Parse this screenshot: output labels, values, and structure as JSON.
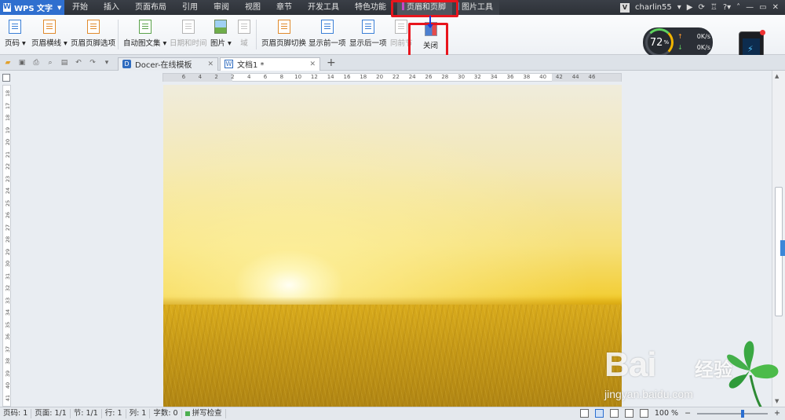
{
  "app": {
    "name": "WPS 文字"
  },
  "menu": {
    "tabs": [
      "开始",
      "插入",
      "页面布局",
      "引用",
      "审阅",
      "视图",
      "章节",
      "开发工具",
      "特色功能"
    ],
    "context_tabs": {
      "header_footer": "页眉和页脚",
      "picture_tools": "图片工具"
    }
  },
  "account": {
    "username": "charlin55"
  },
  "ribbon": {
    "page_number": "页码",
    "header_line": "页眉横线",
    "header_footer_options": "页眉页脚选项",
    "auto_text": "自动图文集",
    "date_time": "日期和时间",
    "picture": "图片",
    "field": "域",
    "switch_header_footer": "页眉页脚切换",
    "show_previous": "显示前一项",
    "show_next": "显示后一项",
    "same_as_previous": "同前节",
    "close": "关闭"
  },
  "speed_widget": {
    "percent": "72",
    "percent_unit": "%",
    "upload": "0K/s",
    "download": "0K/s"
  },
  "doc_tabs": [
    {
      "label": "Docer-在线模板"
    },
    {
      "label": "文档1 *"
    }
  ],
  "ruler": {
    "horizontal": [
      "6",
      "4",
      "2",
      "2",
      "4",
      "6",
      "8",
      "10",
      "12",
      "14",
      "16",
      "18",
      "20",
      "22",
      "24",
      "26",
      "28",
      "30",
      "32",
      "34",
      "36",
      "38",
      "40",
      "42",
      "44",
      "46"
    ],
    "vertical": [
      "18",
      "17",
      "18",
      "19",
      "20",
      "21",
      "22",
      "23",
      "24",
      "25",
      "26",
      "27",
      "28",
      "29",
      "30",
      "31",
      "32",
      "33",
      "34",
      "35",
      "36",
      "37",
      "38",
      "39",
      "40",
      "41",
      "42"
    ]
  },
  "status": {
    "page_num": "页码: 1",
    "page": "页面: 1/1",
    "section": "节: 1/1",
    "row": "行: 1",
    "col": "列: 1",
    "word_count": "字数: 0",
    "spell_check": "拼写检查",
    "zoom": "100 %",
    "zoom_level": 1.0
  },
  "watermark": {
    "logo": "Bai",
    "logo_cn": "经验",
    "url": "jingyan.baidu.com"
  },
  "colors": {
    "accent": "#2f6fcf",
    "highlight": "#e8151d",
    "arrow": "#1a3ad6"
  }
}
